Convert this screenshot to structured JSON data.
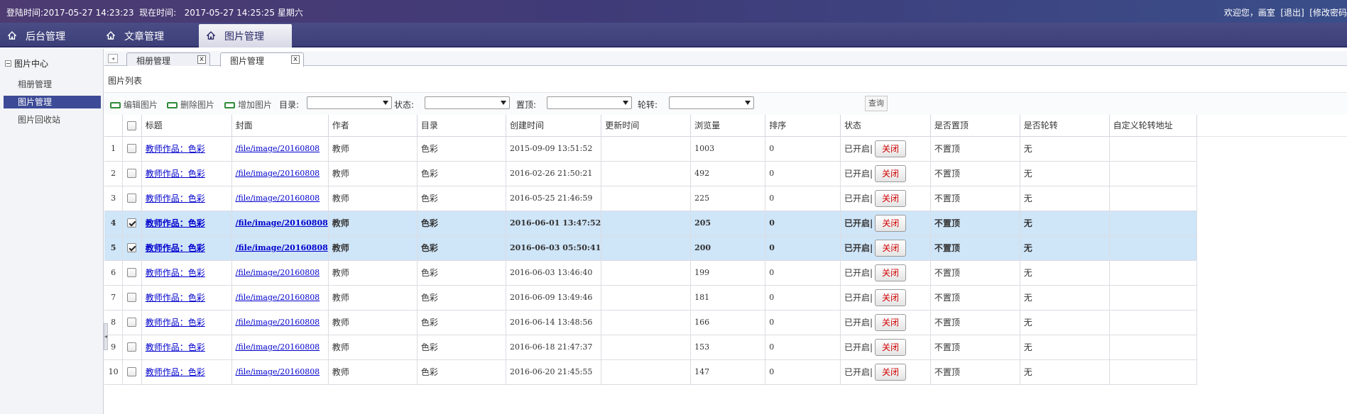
{
  "topbar": {
    "login_info": "登陆时间:2017-05-27 14:23:23  现在时间:   2017-05-27 14:25:25 星期六",
    "user_info": "欢迎您，画室  [退出]  [修改密码"
  },
  "mainnav": {
    "tabs": [
      {
        "label": "后台管理",
        "icon": "home-icon"
      },
      {
        "label": "文章管理",
        "icon": "home-icon"
      },
      {
        "label": "图片管理",
        "icon": "home-icon",
        "active": true
      }
    ]
  },
  "sidebar": {
    "header": "图片中心",
    "items": [
      {
        "label": "相册管理"
      },
      {
        "label": "图片管理",
        "active": true
      },
      {
        "label": "图片回收站"
      }
    ]
  },
  "content_tabs": [
    {
      "label": "相册管理",
      "close": "x"
    },
    {
      "label": "图片管理",
      "close": "x",
      "active": true
    }
  ],
  "panel": {
    "title": "图片列表"
  },
  "toolbar": {
    "edit_label": "编辑图片",
    "delete_label": "删除图片",
    "add_label": "增加图片",
    "filters": [
      {
        "label": "目录:",
        "value": ""
      },
      {
        "label": "状态:",
        "value": ""
      },
      {
        "label": "置顶:",
        "value": ""
      },
      {
        "label": "轮转:",
        "value": ""
      }
    ],
    "query_label": "查询"
  },
  "table": {
    "headers": [
      "",
      "",
      "标题",
      "封面",
      "作者",
      "目录",
      "创建时间",
      "更新时间",
      "浏览量",
      "排序",
      "状态",
      "是否置顶",
      "是否轮转",
      "自定义轮转地址",
      ""
    ],
    "close_label": "关闭",
    "rows": [
      {
        "n": "1",
        "checked": false,
        "title": "教师作品：色彩",
        "cover": "/file/image/20160808",
        "author": "教师",
        "dir": "色彩",
        "created": "2015-09-09 13:51:52",
        "updated": "",
        "views": "1003",
        "order": "0",
        "status": "已开启|",
        "top": "不置顶",
        "rotate": "无",
        "url": ""
      },
      {
        "n": "2",
        "checked": false,
        "title": "教师作品：色彩",
        "cover": "/file/image/20160808",
        "author": "教师",
        "dir": "色彩",
        "created": "2016-02-26 21:50:21",
        "updated": "",
        "views": "492",
        "order": "0",
        "status": "已开启|",
        "top": "不置顶",
        "rotate": "无",
        "url": ""
      },
      {
        "n": "3",
        "checked": false,
        "title": "教师作品：色彩",
        "cover": "/file/image/20160808",
        "author": "教师",
        "dir": "色彩",
        "created": "2016-05-25 21:46:59",
        "updated": "",
        "views": "225",
        "order": "0",
        "status": "已开启|",
        "top": "不置顶",
        "rotate": "无",
        "url": ""
      },
      {
        "n": "4",
        "checked": true,
        "title": "教师作品：色彩",
        "cover": "/file/image/20160808",
        "author": "教师",
        "dir": "色彩",
        "created": "2016-06-01 13:47:52",
        "updated": "",
        "views": "205",
        "order": "0",
        "status": "已开启|",
        "top": "不置顶",
        "rotate": "无",
        "url": ""
      },
      {
        "n": "5",
        "checked": true,
        "title": "教师作品：色彩",
        "cover": "/file/image/20160808",
        "author": "教师",
        "dir": "色彩",
        "created": "2016-06-03 05:50:41",
        "updated": "",
        "views": "200",
        "order": "0",
        "status": "已开启|",
        "top": "不置顶",
        "rotate": "无",
        "url": ""
      },
      {
        "n": "6",
        "checked": false,
        "title": "教师作品：色彩",
        "cover": "/file/image/20160808",
        "author": "教师",
        "dir": "色彩",
        "created": "2016-06-03 13:46:40",
        "updated": "",
        "views": "199",
        "order": "0",
        "status": "已开启|",
        "top": "不置顶",
        "rotate": "无",
        "url": ""
      },
      {
        "n": "7",
        "checked": false,
        "title": "教师作品：色彩",
        "cover": "/file/image/20160808",
        "author": "教师",
        "dir": "色彩",
        "created": "2016-06-09 13:49:46",
        "updated": "",
        "views": "181",
        "order": "0",
        "status": "已开启|",
        "top": "不置顶",
        "rotate": "无",
        "url": ""
      },
      {
        "n": "8",
        "checked": false,
        "title": "教师作品：色彩",
        "cover": "/file/image/20160808",
        "author": "教师",
        "dir": "色彩",
        "created": "2016-06-14 13:48:56",
        "updated": "",
        "views": "166",
        "order": "0",
        "status": "已开启|",
        "top": "不置顶",
        "rotate": "无",
        "url": ""
      },
      {
        "n": "9",
        "checked": false,
        "title": "教师作品：色彩",
        "cover": "/file/image/20160808",
        "author": "教师",
        "dir": "色彩",
        "created": "2016-06-18 21:47:37",
        "updated": "",
        "views": "153",
        "order": "0",
        "status": "已开启|",
        "top": "不置顶",
        "rotate": "无",
        "url": ""
      },
      {
        "n": "10",
        "checked": false,
        "title": "教师作品：色彩",
        "cover": "/file/image/20160808",
        "author": "教师",
        "dir": "色彩",
        "created": "2016-06-20 21:45:55",
        "updated": "",
        "views": "147",
        "order": "0",
        "status": "已开启|",
        "top": "不置顶",
        "rotate": "无",
        "url": ""
      }
    ]
  },
  "colors": {
    "topbar": "#4d3b72",
    "nav": "#3c3f78",
    "sidebar_active": "#3d4b97",
    "row_selected": "#cfe5f8",
    "link": "#0000cc",
    "close_text": "#d00000",
    "toolbar_icon": "#2e8b3a"
  }
}
